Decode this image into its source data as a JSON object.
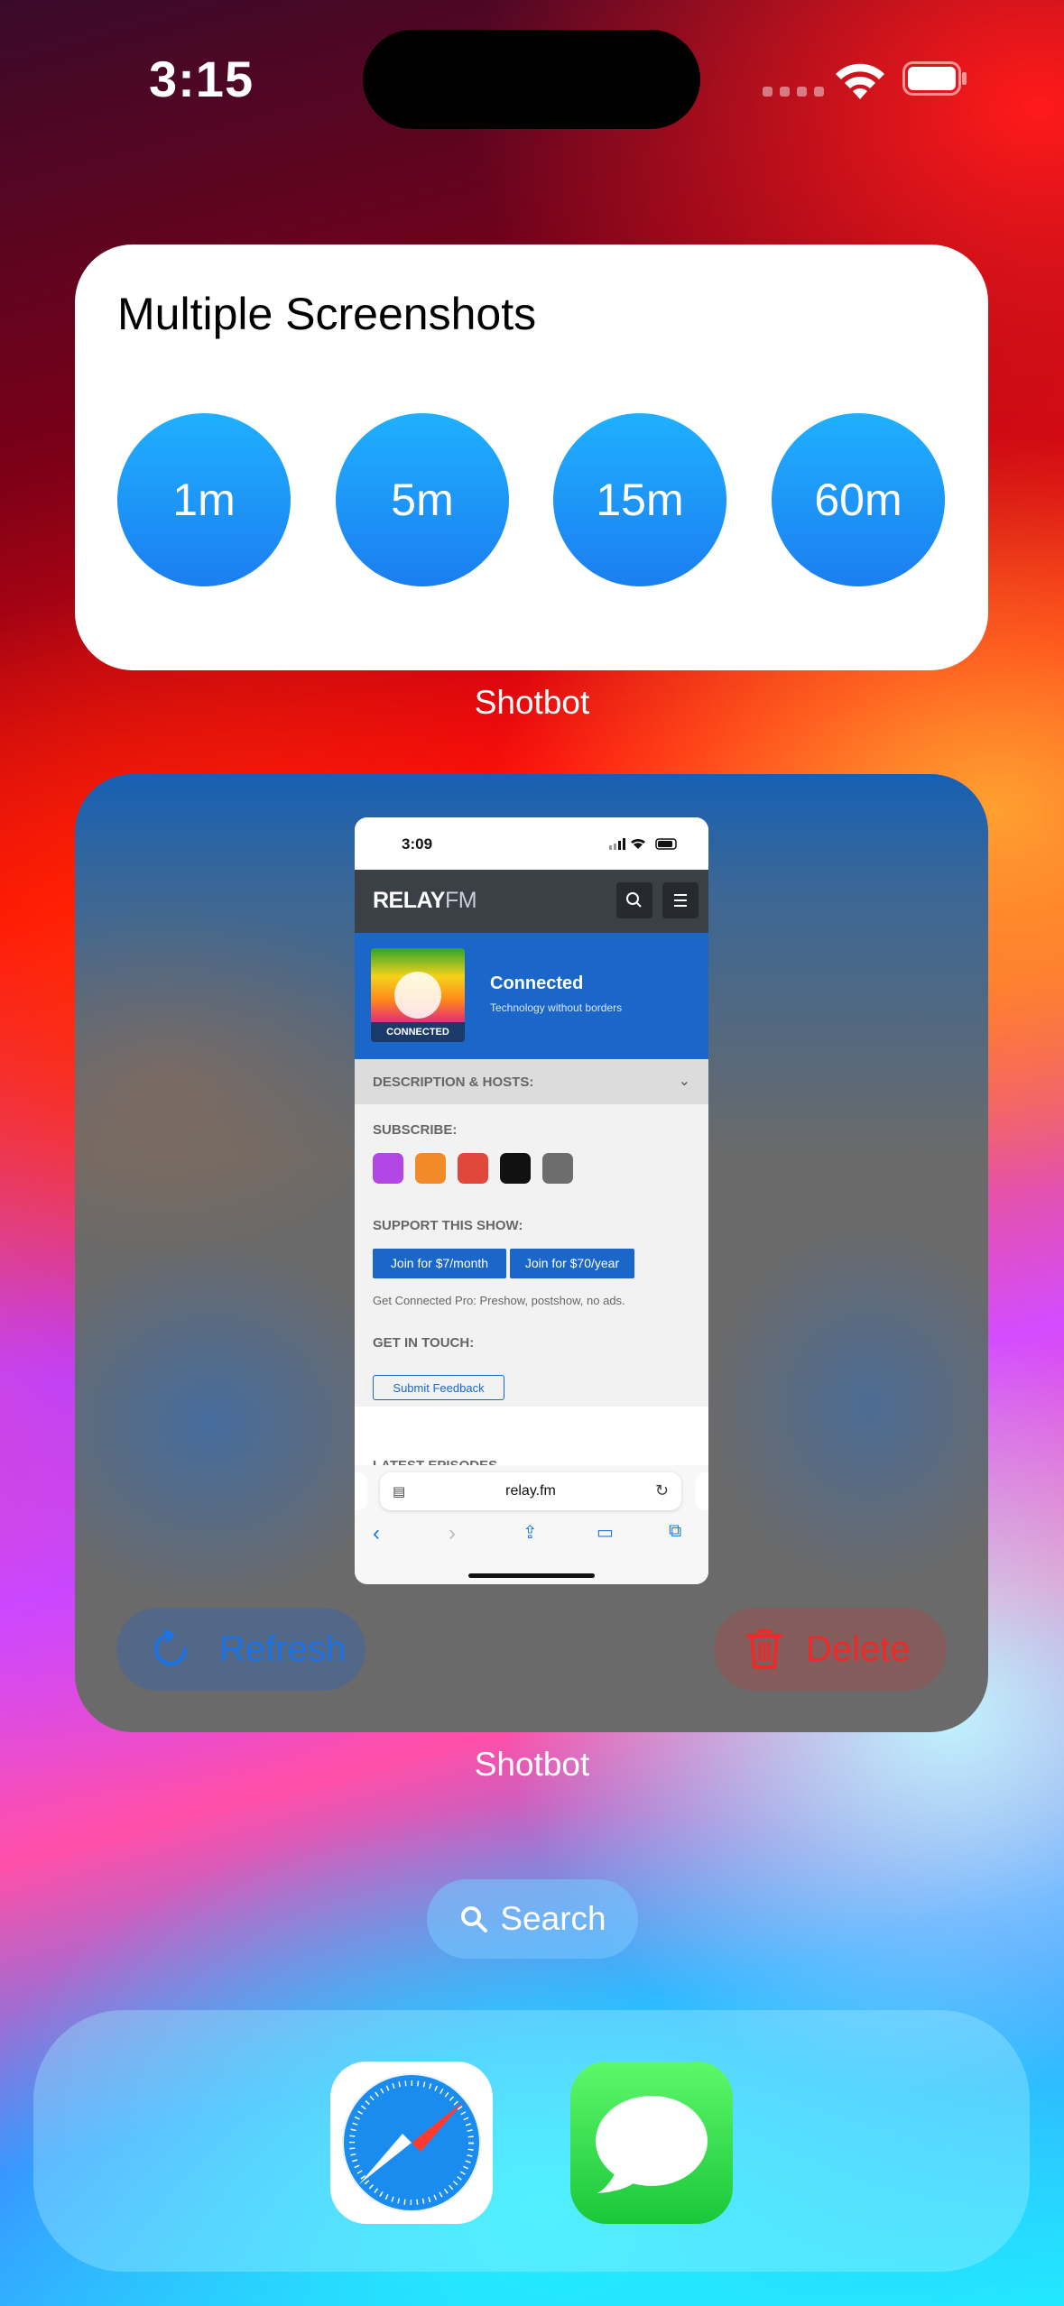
{
  "status_bar": {
    "time": "3:15"
  },
  "widget_screenshots": {
    "title": "Multiple Screenshots",
    "buttons": [
      "1m",
      "5m",
      "15m",
      "60m"
    ],
    "app_label": "Shotbot"
  },
  "widget_preview": {
    "app_label": "Shotbot",
    "refresh_label": "Refresh",
    "delete_label": "Delete",
    "preview": {
      "time": "3:09",
      "site_logo_main": "RELAY",
      "site_logo_fm": "FM",
      "show_name": "Connected",
      "show_tagline": "Technology without borders",
      "artwork_label": "CONNECTED",
      "description_header": "DESCRIPTION & HOSTS:",
      "subscribe_header": "SUBSCRIBE:",
      "support_header": "SUPPORT THIS SHOW:",
      "join_monthly": "Join for $7/month",
      "join_yearly": "Join for $70/year",
      "support_note": "Get Connected Pro: Preshow, postshow, no ads.",
      "contact_header": "GET IN TOUCH:",
      "feedback_button": "Submit Feedback",
      "latest_header": "LATEST EPISODES",
      "url": "relay.fm"
    }
  },
  "search": {
    "label": "Search"
  },
  "dock": {
    "apps": [
      "Safari",
      "Messages"
    ]
  },
  "colors": {
    "accent_blue": "#1b7ef0",
    "delete_red": "#ee2a28"
  }
}
